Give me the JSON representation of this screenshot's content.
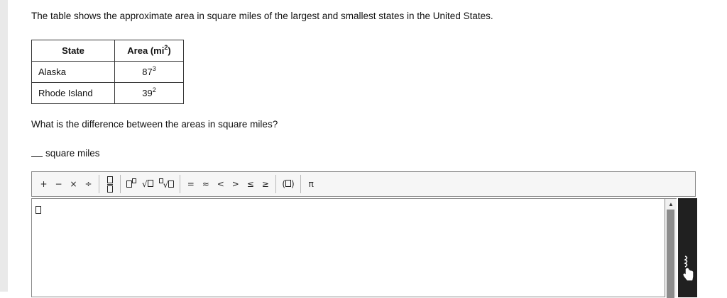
{
  "intro_text": "The table shows the approximate area in square miles of the largest and smallest states in the United States.",
  "table": {
    "headers": {
      "state": "State",
      "area_base": "Area (mi",
      "area_exp": "2",
      "area_close": ")"
    },
    "rows": [
      {
        "state": "Alaska",
        "base": "87",
        "exp": "3"
      },
      {
        "state": "Rhode Island",
        "base": "39",
        "exp": "2"
      }
    ]
  },
  "question": "What is the difference between the areas in square miles?",
  "answer": {
    "unit_label": "square miles"
  },
  "toolbar": {
    "plus": "+",
    "minus": "−",
    "times": "×",
    "divide": "÷",
    "equals": "=",
    "approx": "≈",
    "less": "<",
    "greater": ">",
    "leq": "≤",
    "geq": "≥",
    "parens_open": "(",
    "parens_close": ")",
    "pi": "π"
  },
  "icons": {
    "scroll_up": "▲",
    "hand": "hand-pointer-icon"
  }
}
